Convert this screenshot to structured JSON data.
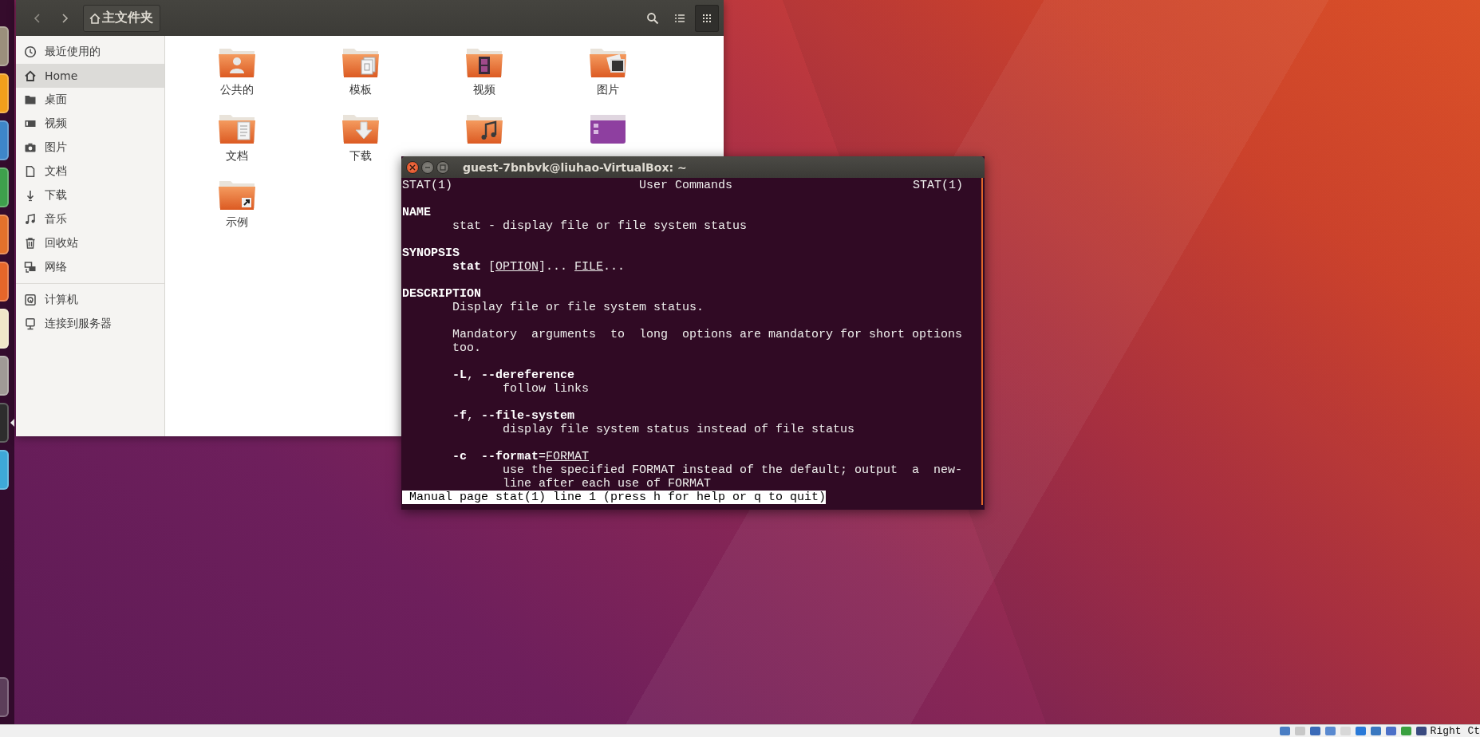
{
  "launcher": {
    "items": [
      {
        "kind": "files",
        "focused": false
      },
      {
        "kind": "browser",
        "focused": false
      },
      {
        "kind": "writer",
        "focused": false
      },
      {
        "kind": "calc",
        "focused": false
      },
      {
        "kind": "impress",
        "focused": false
      },
      {
        "kind": "software",
        "focused": false
      },
      {
        "kind": "shop",
        "focused": false
      },
      {
        "kind": "settings",
        "focused": false
      },
      {
        "kind": "terminal",
        "focused": true
      },
      {
        "kind": "remote",
        "focused": false
      },
      {
        "kind": "trash",
        "focused": false
      }
    ]
  },
  "file_manager": {
    "header": {
      "path_button": {
        "label": "主文件夹"
      },
      "view_buttons": [
        {
          "kind": "list",
          "selected": false
        },
        {
          "kind": "grid",
          "selected": true
        }
      ]
    },
    "sidebar": {
      "groups": [
        {
          "items": [
            {
              "kind": "recent",
              "label": "最近使用的",
              "selected": false
            },
            {
              "kind": "home",
              "label": "Home",
              "selected": true
            },
            {
              "kind": "desktop",
              "label": "桌面",
              "selected": false
            },
            {
              "kind": "videos",
              "label": "视频",
              "selected": false
            },
            {
              "kind": "pictures",
              "label": "图片",
              "selected": false
            },
            {
              "kind": "documents",
              "label": "文档",
              "selected": false
            },
            {
              "kind": "downloads",
              "label": "下载",
              "selected": false
            },
            {
              "kind": "music",
              "label": "音乐",
              "selected": false
            },
            {
              "kind": "trash",
              "label": "回收站",
              "selected": false
            },
            {
              "kind": "network",
              "label": "网络",
              "selected": false
            }
          ]
        },
        {
          "items": [
            {
              "kind": "computer",
              "label": "计算机",
              "selected": false
            },
            {
              "kind": "server",
              "label": "连接到服务器",
              "selected": false
            }
          ]
        }
      ]
    },
    "items": [
      {
        "kind": "public",
        "label": "公共的"
      },
      {
        "kind": "templates",
        "label": "模板"
      },
      {
        "kind": "videos",
        "label": "视频"
      },
      {
        "kind": "pictures",
        "label": "图片"
      },
      {
        "kind": "documents",
        "label": "文档"
      },
      {
        "kind": "downloads",
        "label": "下载"
      },
      {
        "kind": "music"
      },
      {
        "kind": "desktop"
      },
      {
        "kind": "examples",
        "label": "示例"
      }
    ]
  },
  "terminal": {
    "title": "guest-7bnbvk@liuhao-VirtualBox: ~",
    "lines": [
      {
        "kind": "header",
        "left": "STAT(1)",
        "center": "User Commands",
        "right": "STAT(1)"
      },
      {
        "kind": "blank"
      },
      {
        "kind": "heading",
        "text": "NAME"
      },
      {
        "kind": "body",
        "text": "stat - display file or file system status"
      },
      {
        "kind": "blank"
      },
      {
        "kind": "heading",
        "text": "SYNOPSIS"
      },
      {
        "kind": "body",
        "segments": [
          {
            "text": "stat",
            "kind": "bold"
          },
          {
            "text": " [",
            "kind": "plain"
          },
          {
            "text": "OPTION",
            "kind": "underline"
          },
          {
            "text": "]... ",
            "kind": "plain"
          },
          {
            "text": "FILE",
            "kind": "underline"
          },
          {
            "text": "...",
            "kind": "plain"
          }
        ]
      },
      {
        "kind": "blank"
      },
      {
        "kind": "heading",
        "text": "DESCRIPTION"
      },
      {
        "kind": "body",
        "text": "Display file or file system status."
      },
      {
        "kind": "blank"
      },
      {
        "kind": "body",
        "text": "Mandatory  arguments  to  long  options are mandatory for short options"
      },
      {
        "kind": "body",
        "text": "too."
      },
      {
        "kind": "blank"
      },
      {
        "kind": "body",
        "segments": [
          {
            "text": "-L",
            "kind": "bold"
          },
          {
            "text": ", ",
            "kind": "plain"
          },
          {
            "text": "--dereference",
            "kind": "bold"
          }
        ]
      },
      {
        "kind": "detail",
        "text": "follow links"
      },
      {
        "kind": "blank"
      },
      {
        "kind": "body",
        "segments": [
          {
            "text": "-f",
            "kind": "bold"
          },
          {
            "text": ", ",
            "kind": "plain"
          },
          {
            "text": "--file-system",
            "kind": "bold"
          }
        ]
      },
      {
        "kind": "detail",
        "text": "display file system status instead of file status"
      },
      {
        "kind": "blank"
      },
      {
        "kind": "body",
        "segments": [
          {
            "text": "-c  --format",
            "kind": "bold"
          },
          {
            "text": "=",
            "kind": "plain"
          },
          {
            "text": "FORMAT",
            "kind": "underline"
          }
        ]
      },
      {
        "kind": "detail",
        "text": "use the specified FORMAT instead of the default; output  a  new‐"
      },
      {
        "kind": "detail",
        "text": "line after each use of FORMAT"
      }
    ],
    "status": "Manual page stat(1) line 1 (press h for help or q to quit)"
  },
  "status_bar": {
    "host_key": "Right Ct"
  }
}
